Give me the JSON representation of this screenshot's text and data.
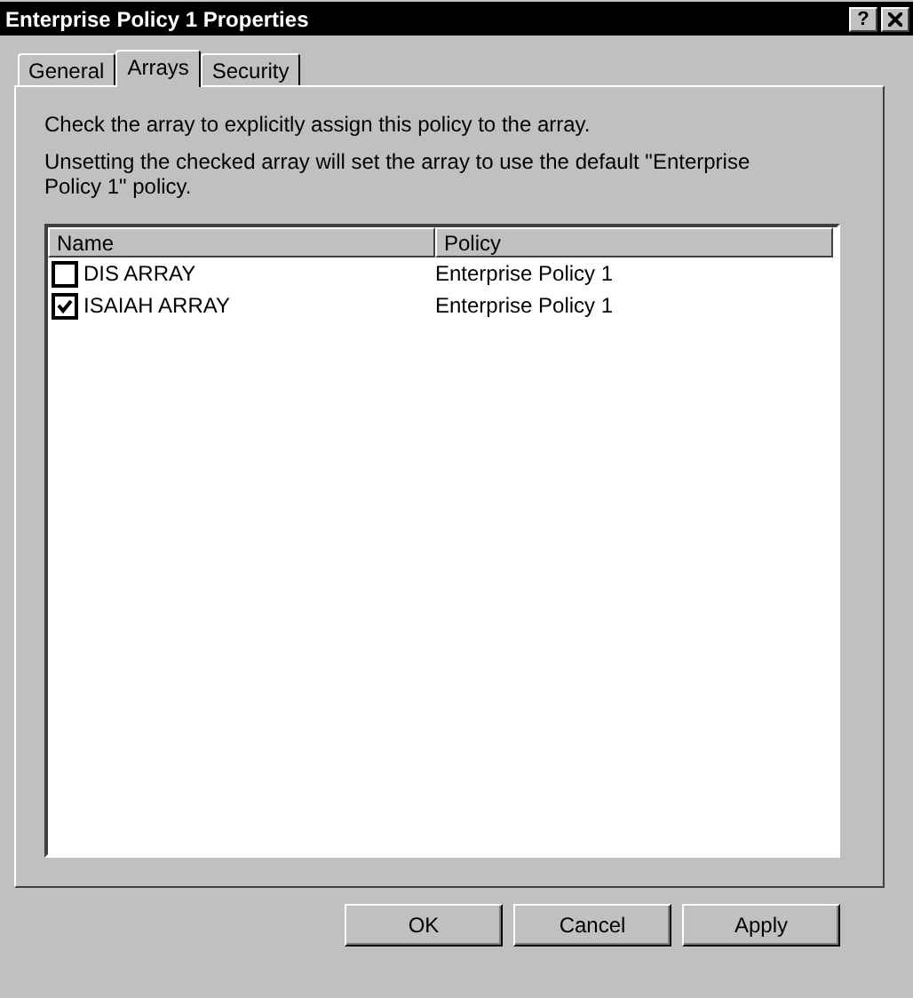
{
  "window": {
    "title": "Enterprise Policy 1 Properties",
    "help": "?"
  },
  "tabs": [
    {
      "label": "General",
      "selected": false
    },
    {
      "label": "Arrays",
      "selected": true
    },
    {
      "label": "Security",
      "selected": false
    }
  ],
  "instructions": [
    "Check the array to explicitly assign this policy to the array.",
    "Unsetting the checked array will set the array to use the default \"Enterprise Policy 1\" policy."
  ],
  "table": {
    "columns": [
      "Name",
      "Policy"
    ],
    "rows": [
      {
        "name": "DIS ARRAY",
        "policy": "Enterprise Policy 1",
        "checked": false
      },
      {
        "name": "ISAIAH ARRAY",
        "policy": "Enterprise Policy 1",
        "checked": true
      }
    ]
  },
  "buttons": [
    "OK",
    "Cancel",
    "Apply"
  ]
}
